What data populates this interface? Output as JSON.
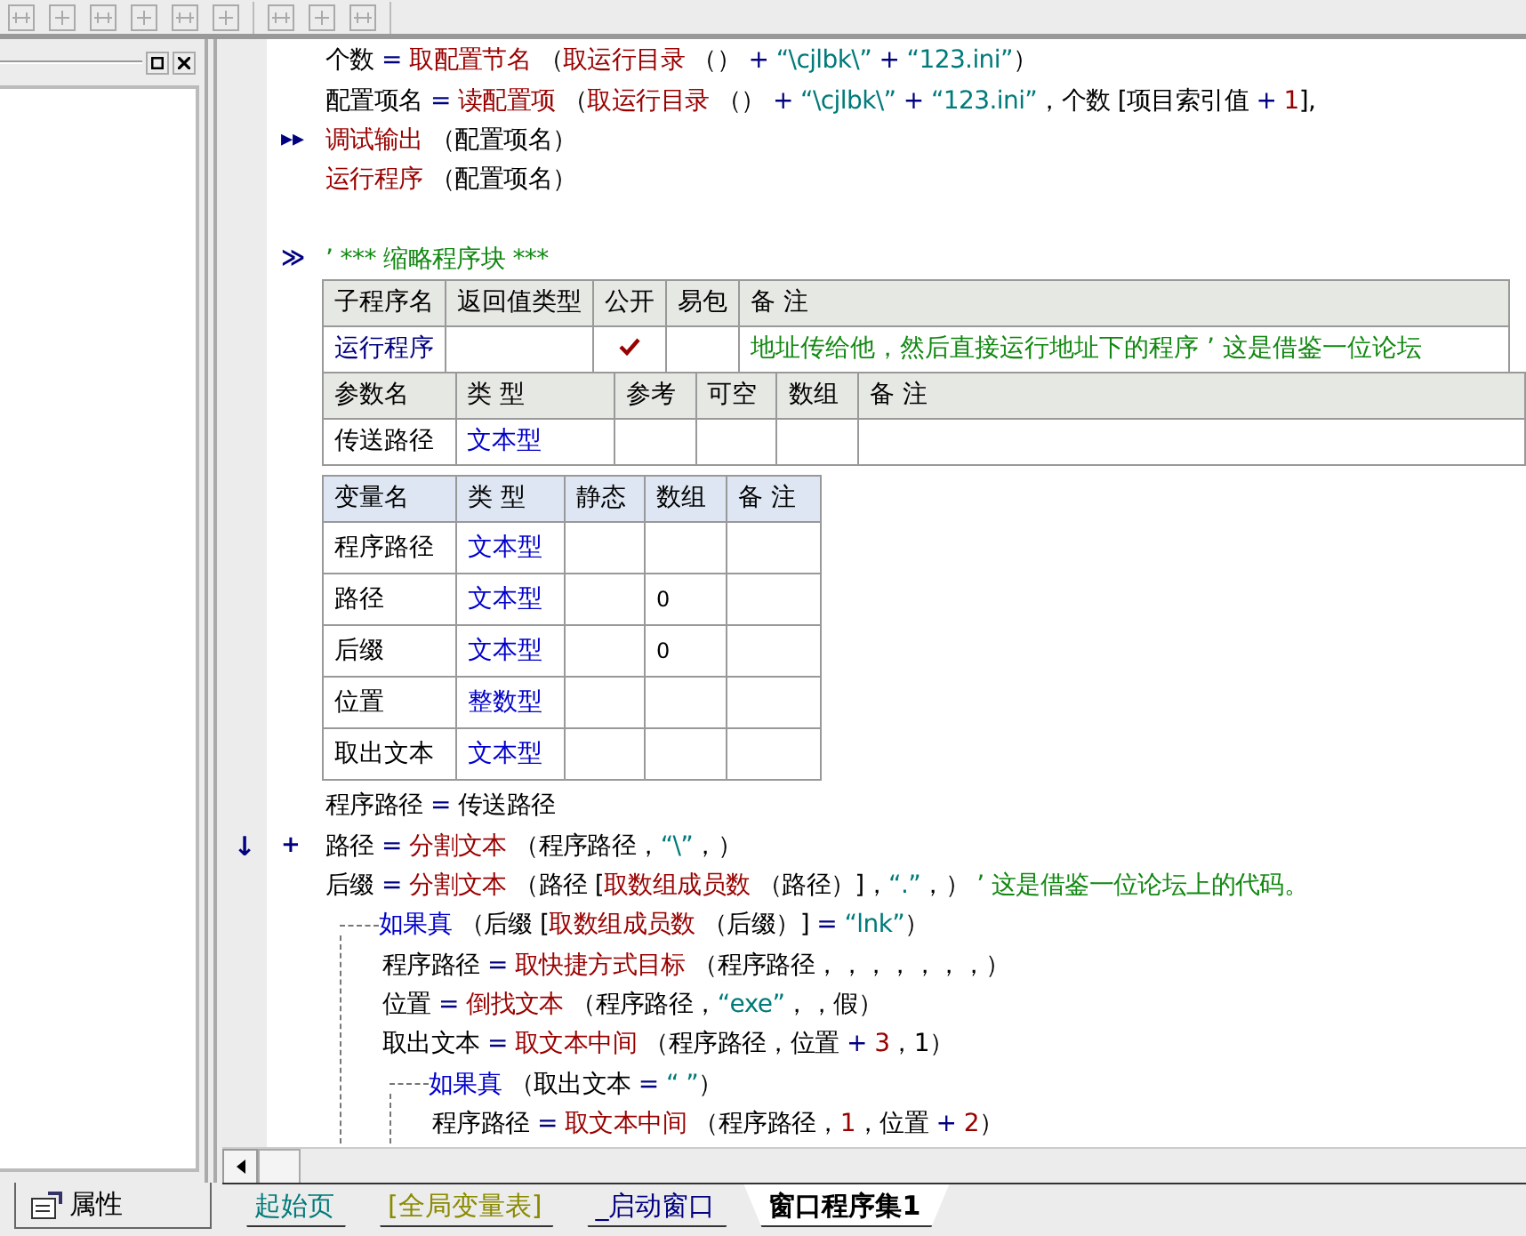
{
  "left_panel": {
    "bottom_tab": {
      "label": "属性"
    }
  },
  "code_before": [
    {
      "tokens": [
        {
          "kind": "plain",
          "text": "个数"
        },
        {
          "kind": "op",
          "text": " = "
        },
        {
          "kind": "func",
          "text": "取配置节名"
        },
        {
          "kind": "plain",
          "text": " （"
        },
        {
          "kind": "func",
          "text": "取运行目录"
        },
        {
          "kind": "plain",
          "text": " （） "
        },
        {
          "kind": "op",
          "text": "+ "
        },
        {
          "kind": "string",
          "text": "“\\cjlbk\\”"
        },
        {
          "kind": "op",
          "text": " + "
        },
        {
          "kind": "string",
          "text": "“123.ini”"
        },
        {
          "kind": "plain",
          "text": "）"
        }
      ]
    },
    {
      "tokens": [
        {
          "kind": "plain",
          "text": "配置项名"
        },
        {
          "kind": "op",
          "text": " = "
        },
        {
          "kind": "func",
          "text": "读配置项"
        },
        {
          "kind": "plain",
          "text": " （"
        },
        {
          "kind": "func",
          "text": "取运行目录"
        },
        {
          "kind": "plain",
          "text": " （） "
        },
        {
          "kind": "op",
          "text": "+ "
        },
        {
          "kind": "string",
          "text": "“\\cjlbk\\”"
        },
        {
          "kind": "op",
          "text": " + "
        },
        {
          "kind": "string",
          "text": "“123.ini”"
        },
        {
          "kind": "plain",
          "text": "，个数 [项目索引值 "
        },
        {
          "kind": "op",
          "text": "+ "
        },
        {
          "kind": "number",
          "text": "1"
        },
        {
          "kind": "plain",
          "text": "],"
        }
      ]
    },
    {
      "marker": "▸▸",
      "tokens": [
        {
          "kind": "func",
          "text": "调试输出"
        },
        {
          "kind": "plain",
          "text": " （配置项名）"
        }
      ]
    },
    {
      "tokens": [
        {
          "kind": "func",
          "text": "运行程序"
        },
        {
          "kind": "plain",
          "text": " （配置项名）"
        }
      ]
    }
  ],
  "collapsed_block": {
    "marker": "≫",
    "tokens": [
      {
        "kind": "comment",
        "text": "’ *** 缩略程序块 ***"
      }
    ]
  },
  "subroutine_table": {
    "header": [
      "子程序名",
      "返回值类型",
      "公开",
      "易包",
      "备 注"
    ],
    "row": {
      "name": "运行程序",
      "public": true,
      "easy_pack": false,
      "comment": "地址传给他，然后直接运行地址下的程序 ’ 这是借鉴一位论坛"
    },
    "param_header": [
      "参数名",
      "类 型",
      "参考",
      "可空",
      "数组",
      "备 注"
    ],
    "params": [
      {
        "name": "传送路径",
        "type": "文本型"
      }
    ]
  },
  "variable_table": {
    "header": [
      "变量名",
      "类 型",
      "静态",
      "数组",
      "备 注"
    ],
    "rows": [
      {
        "name": "程序路径",
        "type": "文本型"
      },
      {
        "name": "路径",
        "type": "文本型",
        "array": "0"
      },
      {
        "name": "后缀",
        "type": "文本型",
        "array": "0"
      },
      {
        "name": "位置",
        "type": "整数型"
      },
      {
        "name": "取出文本",
        "type": "文本型"
      }
    ]
  },
  "code_after": [
    {
      "tokens": [
        {
          "kind": "plain",
          "text": "程序路径"
        },
        {
          "kind": "op",
          "text": " = "
        },
        {
          "kind": "plain",
          "text": "传送路径"
        }
      ]
    },
    {
      "gutter_mark": "↓",
      "marker": "+",
      "tokens": [
        {
          "kind": "plain",
          "text": "路径"
        },
        {
          "kind": "op",
          "text": " = "
        },
        {
          "kind": "func",
          "text": "分割文本"
        },
        {
          "kind": "plain",
          "text": " （程序路径，"
        },
        {
          "kind": "string",
          "text": "“\\”"
        },
        {
          "kind": "plain",
          "text": "，）"
        }
      ]
    },
    {
      "tokens": [
        {
          "kind": "plain",
          "text": "后缀"
        },
        {
          "kind": "op",
          "text": " = "
        },
        {
          "kind": "func",
          "text": "分割文本"
        },
        {
          "kind": "plain",
          "text": " （路径 ["
        },
        {
          "kind": "func",
          "text": "取数组成员数"
        },
        {
          "kind": "plain",
          "text": " （路径）]，"
        },
        {
          "kind": "string",
          "text": "“.”"
        },
        {
          "kind": "plain",
          "text": "，） "
        },
        {
          "kind": "comment",
          "text": "’ 这是借鉴一位论坛上的代码。"
        }
      ]
    },
    {
      "tokens": [
        {
          "kind": "keyword",
          "text": "如果真"
        },
        {
          "kind": "plain",
          "text": " （后缀 ["
        },
        {
          "kind": "func",
          "text": "取数组成员数"
        },
        {
          "kind": "plain",
          "text": " （后缀）]"
        },
        {
          "kind": "op",
          "text": " = "
        },
        {
          "kind": "string",
          "text": "“lnk”"
        },
        {
          "kind": "plain",
          "text": "）"
        }
      ],
      "children": [
        {
          "tokens": [
            {
              "kind": "plain",
              "text": "程序路径"
            },
            {
              "kind": "op",
              "text": " = "
            },
            {
              "kind": "func",
              "text": "取快捷方式目标"
            },
            {
              "kind": "plain",
              "text": " （程序路径，，，，，，，）"
            }
          ]
        },
        {
          "tokens": [
            {
              "kind": "plain",
              "text": "位置"
            },
            {
              "kind": "op",
              "text": " = "
            },
            {
              "kind": "func",
              "text": "倒找文本"
            },
            {
              "kind": "plain",
              "text": " （程序路径，"
            },
            {
              "kind": "string",
              "text": "“exe”"
            },
            {
              "kind": "plain",
              "text": "，，假）"
            }
          ]
        },
        {
          "tokens": [
            {
              "kind": "plain",
              "text": "取出文本"
            },
            {
              "kind": "op",
              "text": " = "
            },
            {
              "kind": "func",
              "text": "取文本中间"
            },
            {
              "kind": "plain",
              "text": " （程序路径，位置 "
            },
            {
              "kind": "op",
              "text": "+ "
            },
            {
              "kind": "number",
              "text": "3"
            },
            {
              "kind": "plain",
              "text": "，1）"
            }
          ]
        },
        {
          "tokens": [
            {
              "kind": "keyword",
              "text": "如果真"
            },
            {
              "kind": "plain",
              "text": " （取出文本"
            },
            {
              "kind": "op",
              "text": " = "
            },
            {
              "kind": "string",
              "text": "“ ”"
            },
            {
              "kind": "plain",
              "text": "）"
            }
          ],
          "children": [
            {
              "tokens": [
                {
                  "kind": "plain",
                  "text": "程序路径"
                },
                {
                  "kind": "op",
                  "text": " = "
                },
                {
                  "kind": "func",
                  "text": "取文本中间"
                },
                {
                  "kind": "plain",
                  "text": " （程序路径，"
                },
                {
                  "kind": "number",
                  "text": "1"
                },
                {
                  "kind": "plain",
                  "text": "，位置 "
                },
                {
                  "kind": "op",
                  "text": "+ "
                },
                {
                  "kind": "number",
                  "text": "2"
                },
                {
                  "kind": "plain",
                  "text": "）"
                }
              ]
            }
          ]
        }
      ]
    }
  ],
  "tabs": [
    {
      "label": "起始页",
      "kind": "start",
      "selected": false
    },
    {
      "label": "[全局变量表]",
      "kind": "globals",
      "selected": false
    },
    {
      "label": "_启动窗口",
      "kind": "window",
      "selected": false
    },
    {
      "label": "窗口程序集1",
      "kind": "module",
      "selected": true
    }
  ]
}
